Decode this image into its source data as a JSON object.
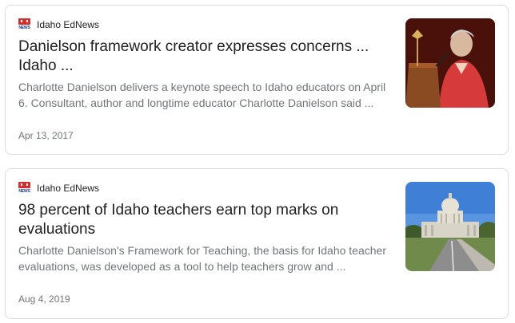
{
  "results": [
    {
      "source": "Idaho EdNews",
      "logo_text": "NEWS",
      "headline": "Danielson framework creator expresses concerns ... Idaho ...",
      "snippet": "Charlotte Danielson delivers a keynote speech to Idaho educators on April 6. Consultant, author and longtime educator Charlotte Danielson said ...",
      "date": "Apr 13, 2017",
      "thumbnail": "speaker-at-podium-photo"
    },
    {
      "source": "Idaho EdNews",
      "logo_text": "NEWS",
      "headline": "98 percent of Idaho teachers earn top marks on evaluations",
      "snippet": "Charlotte Danielson's Framework for Teaching, the basis for Idaho teacher evaluations, was developed as a tool to help teachers grow and ...",
      "date": "Aug 4, 2019",
      "thumbnail": "idaho-capitol-building-photo"
    }
  ],
  "colors": {
    "headline": "#202124",
    "snippet": "#70757a",
    "border": "#dadce0",
    "logo_red": "#d32f2f",
    "logo_blue": "#1a3a8a"
  }
}
